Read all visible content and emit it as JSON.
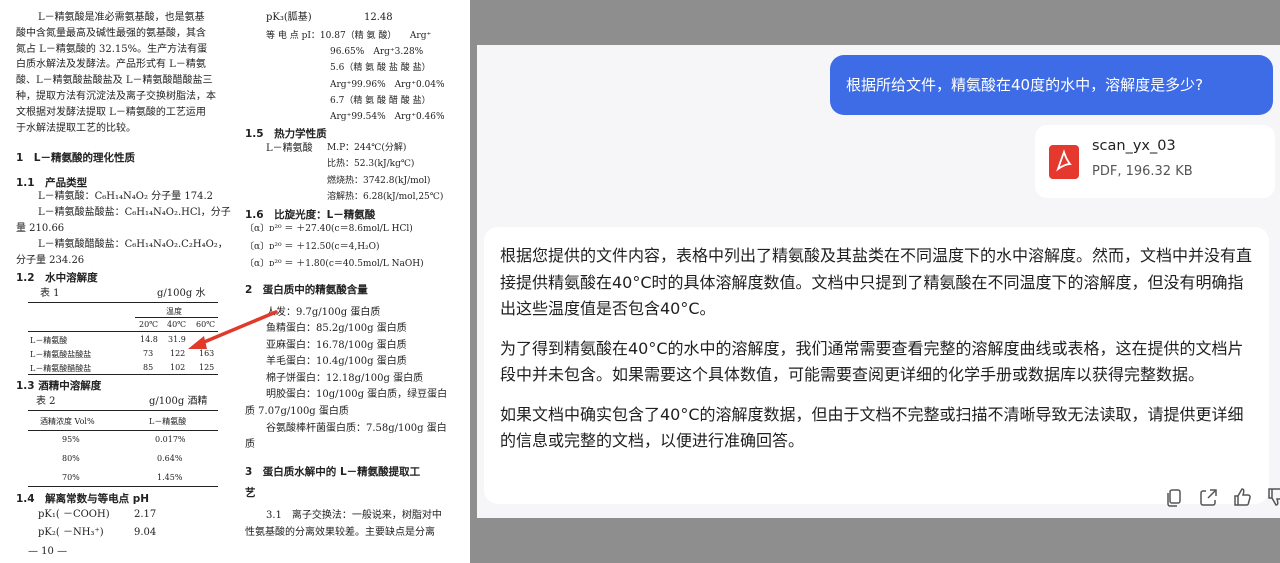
{
  "document": {
    "left_col": {
      "intro": [
        "L－精氨酸是准必需氨基酸，也是氨基",
        "酸中含氮量最高及碱性最强的氨基酸，其含",
        "氮占 L－精氨酸的 32.15%。生产方法有蛋",
        "白质水解法及发酵法。产品形式有 L－精氨",
        "酸、L－精氨酸盐酸盐及 L－精氨酸醋酸盐三",
        "种，提取方法有沉淀法及离子交换树脂法，本",
        "文根据对发酵法提取 L－精氨酸的工艺运用",
        "于水解法提取工艺的比较。"
      ],
      "s1": "1　L－精氨酸的理化性质",
      "s11": "1.1　产品类型",
      "types": [
        "L－精氨酸：C₆H₁₄N₄O₂ 分子量 174.2",
        "L－精氨酸盐酸盐：C₆H₁₄N₄O₂.HCl，分子",
        "量 210.66",
        "L－精氨酸醋酸盐：C₆H₁₄N₄O₂.C₂H₄O₂，",
        "分子量 234.26"
      ],
      "s12": "1.2　水中溶解度",
      "t1_title": "表 1",
      "t1_unit": "g/100g 水",
      "t1_head_temp": "温度",
      "t1_cols": [
        "20℃",
        "40℃",
        "60℃"
      ],
      "t1_rows": [
        {
          "name": "L－精氨酸",
          "v": [
            "14.8",
            "31.9",
            ""
          ]
        },
        {
          "name": "L－精氨酸盐酸盐",
          "v": [
            "73",
            "122",
            "163"
          ]
        },
        {
          "name": "L－精氨酸醋酸盐",
          "v": [
            "85",
            "102",
            "125"
          ]
        }
      ],
      "s13": "1.3 酒精中溶解度",
      "t2_title": "表 2",
      "t2_unit": "g/100g 酒精",
      "t2_h1": "酒精浓度 Vol%",
      "t2_h2": "L－精氨酸",
      "t2_rows": [
        [
          "95%",
          "0.017%"
        ],
        [
          "80%",
          "0.64%"
        ],
        [
          "70%",
          "1.45%"
        ]
      ],
      "s14": "1.4　解离常数与等电点 pH",
      "pk1_label": "pK₁( －COOH)",
      "pk1_val": "2.17",
      "pk2_label": "pK₂( －NH₃⁺)",
      "pk2_val": "9.04",
      "page_no": "— 10 —"
    },
    "right_col": {
      "pk3_label": "pK₃(胍基)",
      "pk3_val": "12.48",
      "pi": [
        "等 电 点 pI：10.87（精 氨 酸）　　Arg⁺",
        "96.65%　Arg⁺3.28%",
        "5.6（精 氨 酸 盐 酸 盐）",
        "Arg⁺99.96%　Arg⁺0.04%",
        "6.7（精 氨 酸 醋 酸 盐）",
        "Arg⁺99.54%　Arg⁺0.46%"
      ],
      "s15": "1.5　热力学性质",
      "thermo_label": "L－精氨酸",
      "thermo": [
        "M.P：244℃(分解)",
        "比热：52.3(kJ/kg℃)",
        "燃烧热：3742.8(kJ/mol)",
        "溶解热：6.28(kJ/mol,25℃)"
      ],
      "s16": "1.6　比旋光度：L－精氨酸",
      "rot": [
        "〔α〕ᴅ²⁰ ＝ ＋27.40(c＝8.6mol/L HCl)",
        "〔α〕ᴅ²⁰ ＝ ＋12.50(c＝4,H₂O)",
        "〔α〕ᴅ²⁰ ＝ ＋1.80(c＝40.5mol/L NaOH)"
      ],
      "s2": "2　蛋白质中的精氨酸含量",
      "content": [
        "人发：9.7g/100g 蛋白质",
        "鱼精蛋白：85.2g/100g 蛋白质",
        "亚麻蛋白：16.78/100g 蛋白质",
        "羊毛蛋白：10.4g/100g 蛋白质",
        "棉子饼蛋白：12.18g/100g 蛋白质",
        "明胶蛋白：10g/100g 蛋白质，绿豆蛋白",
        "质 7.07g/100g 蛋白质",
        "谷氨酸棒杆菌蛋白质：7.58g/100g 蛋白",
        "质"
      ],
      "s3a": "3　蛋白质水解中的 L－精氨酸提取工",
      "s3b": "艺",
      "p31a": "3.1　离子交换法：一般说来，树脂对中",
      "p31b": "性氨基酸的分离效果较差。主要缺点是分离"
    }
  },
  "chat": {
    "user_message": "根据所给文件，精氨酸在40度的水中，溶解度是多少?",
    "file": {
      "name": "scan_yx_03",
      "size": "PDF, 196.32 KB",
      "icon": "pdf-file-icon"
    },
    "answer": [
      "根据您提供的文件内容，表格中列出了精氨酸及其盐类在不同温度下的水中溶解度。然而，文档中并没有直接提供精氨酸在40°C时的具体溶解度数值。文档中只提到了精氨酸在不同温度下的溶解度，但没有明确指出这些温度值是否包含40°C。",
      "为了得到精氨酸在40°C的水中的溶解度，我们通常需要查看完整的溶解度曲线或表格，这在提供的文档片段中并未包含。如果需要这个具体数值，可能需要查阅更详细的化学手册或数据库以获得完整数据。",
      "如果文档中确实包含了40°C的溶解度数据，但由于文档不完整或扫描不清晰导致无法读取，请提供更详细的信息或完整的文档，以便进行准确回答。"
    ],
    "actions": [
      "copy-icon",
      "share-icon",
      "thumbs-up-icon",
      "thumbs-down-icon"
    ],
    "colors": {
      "user_bubble": "#3d6ce6",
      "annotation_arrow": "#e03a2a"
    }
  }
}
